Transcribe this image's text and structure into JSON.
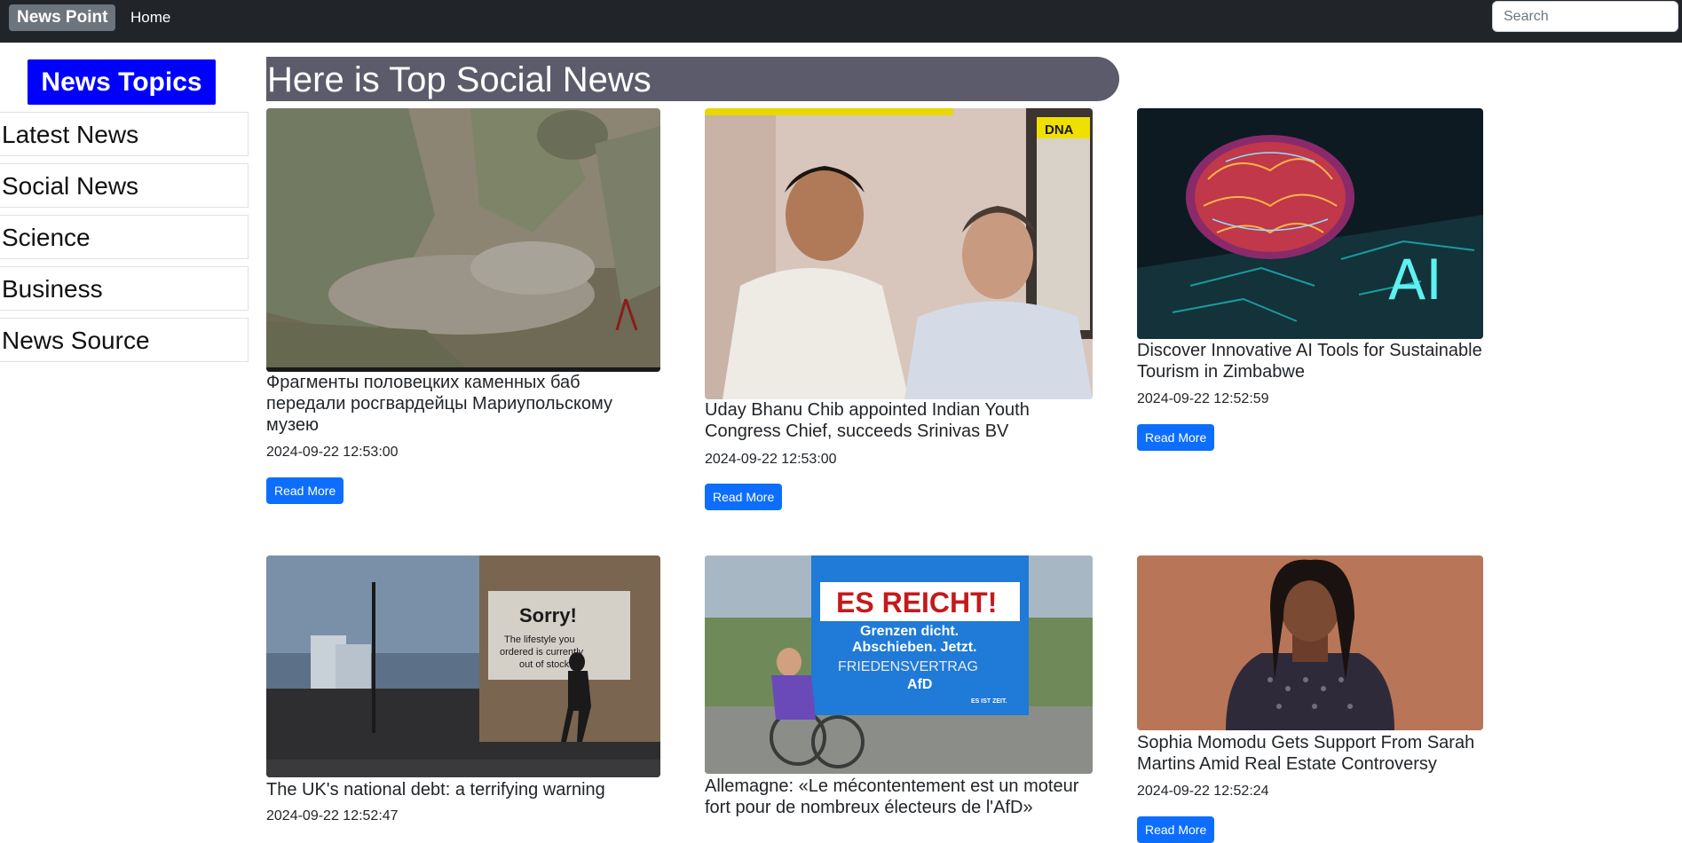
{
  "navbar": {
    "brand": "News Point",
    "home_label": "Home",
    "search_placeholder": "Search"
  },
  "sidebar": {
    "title": "News Topics",
    "items": [
      {
        "label": "Latest News"
      },
      {
        "label": "Social News"
      },
      {
        "label": "Science"
      },
      {
        "label": "Business"
      },
      {
        "label": "News Source"
      }
    ]
  },
  "main": {
    "heading": "Here is Top Social News",
    "read_more_label": "Read More",
    "articles": [
      {
        "title": "Фрагменты половецких каменных баб передали росгвардейцы Мариупольскому музею",
        "date": "2024-09-22 12:53:00",
        "image": "soldiers-excavating-stone-statue-photo"
      },
      {
        "title": "Uday Bhanu Chib appointed Indian Youth Congress Chief, succeeds Srinivas BV",
        "date": "2024-09-22 12:53:00",
        "image": "two-men-portrait-photo",
        "image_text": "DNA"
      },
      {
        "title": "Discover Innovative AI Tools for Sustainable Tourism in Zimbabwe",
        "date": "2024-09-22 12:52:59",
        "image": "ai-brain-circuit-illustration",
        "image_text": "AI"
      },
      {
        "title": "The UK's national debt: a terrifying warning",
        "date": "2024-09-22 12:52:47",
        "image": "london-street-sorry-billboard-photo",
        "image_text": "Sorry! The lifestyle you ordered is currently out of stock"
      },
      {
        "title": "Allemagne: «Le mécontentement est un moteur fort pour de nombreux électeurs de l'AfD»",
        "date": "",
        "image": "afd-election-poster-cyclist-photo",
        "image_text": "ES REICHT! Grenzen dicht. Abschieben. Jetzt. FRIEDENSVERTRAG AfD ES IST ZEIT."
      },
      {
        "title": "Sophia Momodu Gets Support From Sarah Martins Amid Real Estate Controversy",
        "date": "2024-09-22 12:52:24",
        "image": "woman-portrait-photo"
      }
    ]
  }
}
